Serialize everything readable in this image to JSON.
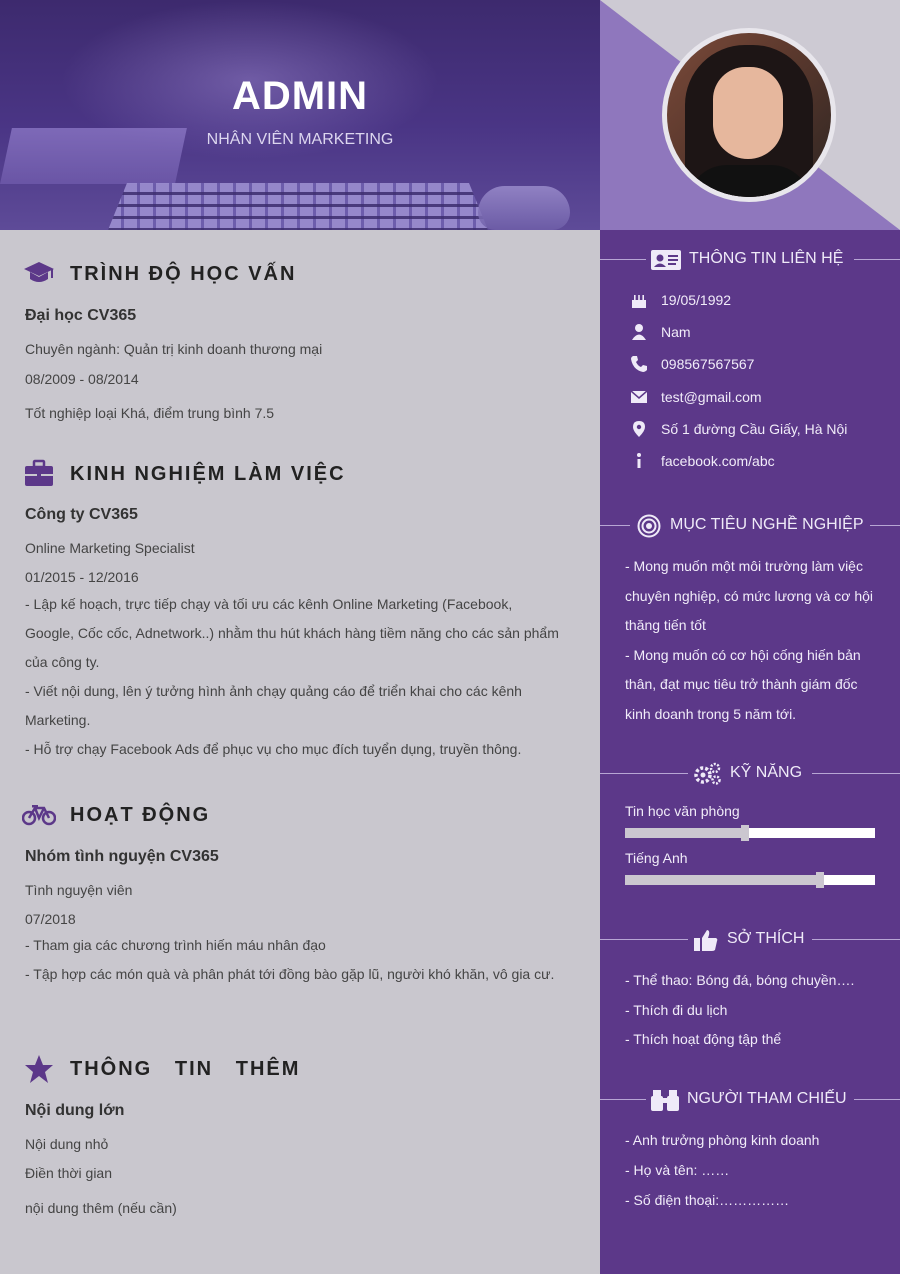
{
  "header": {
    "name": "ADMIN",
    "job_title": "NHÂN VIÊN MARKETING"
  },
  "education": {
    "title": "TRÌNH ĐỘ HỌC VẤN",
    "icon": "graduation-cap-icon",
    "school": "Đại học CV365",
    "major": "Chuyên ngành: Quản trị kinh doanh thương mại",
    "period": "08/2009 - 08/2014",
    "result": "Tốt nghiệp loại Khá, điểm trung bình 7.5"
  },
  "experience": {
    "title": "KINH NGHIỆM LÀM VIỆC",
    "icon": "briefcase-icon",
    "company": "Công ty CV365",
    "position": "Online Marketing Specialist",
    "period": "01/2015 - 12/2016",
    "description": "- Lập kế hoạch, trực tiếp chạy và tối ưu các kênh Online Marketing (Facebook, Google, Cốc cốc, Adnetwork..) nhằm thu hút khách hàng tiềm năng cho các sản phẩm của công ty.\n- Viết nội dung, lên ý tưởng hình ảnh chạy quảng cáo để triển khai cho các kênh Marketing.\n- Hỗ trợ chạy Facebook Ads để phục vụ cho mục đích tuyển dụng, truyền thông."
  },
  "activities": {
    "title": "HOẠT ĐỘNG",
    "icon": "bicycle-icon",
    "organization": "Nhóm tình nguyện CV365",
    "role": "Tình nguyện viên",
    "period": "07/2018",
    "description": "- Tham gia các chương trình hiến máu nhân đạo\n- Tập hợp các món quà và phân phát tới đồng bào gặp lũ, người khó khăn, vô gia cư."
  },
  "additional": {
    "title": "THÔNG   TIN   THÊM",
    "icon": "star-icon",
    "main": "Nội dung lớn",
    "sub": "Nội dung nhỏ",
    "time": "Điền thời gian",
    "extra": "nội dung thêm (nếu cần)"
  },
  "contact": {
    "title": "THÔNG TIN LIÊN HỆ",
    "birthday": "19/05/1992",
    "gender": "Nam",
    "phone": "098567567567",
    "email": "test@gmail.com",
    "address": "Số 1 đường Cầu Giấy, Hà Nội",
    "website": "facebook.com/abc"
  },
  "objective": {
    "title": "MỤC TIÊU NGHỀ NGHIỆP",
    "text": "- Mong muốn một môi trường làm việc chuyên nghiệp, có mức lương và cơ hội thăng tiến tốt\n- Mong muốn có cơ hội cống hiến bản thân, đạt mục tiêu trở thành giám đốc kinh doanh trong 5 năm tới."
  },
  "skills": {
    "title": "KỸ NĂNG",
    "items": [
      {
        "name": "Tin học văn phòng",
        "level": 0.48
      },
      {
        "name": "Tiếng Anh",
        "level": 0.78
      }
    ]
  },
  "hobbies": {
    "title": "SỞ THÍCH",
    "items": [
      "- Thể thao: Bóng đá, bóng chuyền….",
      "- Thích đi du lịch",
      "- Thích hoạt động tập thể"
    ]
  },
  "references": {
    "title": "NGƯỜI THAM CHIẾU",
    "items": [
      "- Anh trưởng phòng kinh doanh",
      "- Họ và tên: ……",
      "- Số điện thoại:……………"
    ]
  },
  "colors": {
    "accent": "#5c3889",
    "left_bg": "#c9c7ce",
    "header_bg": "#4a3585"
  }
}
